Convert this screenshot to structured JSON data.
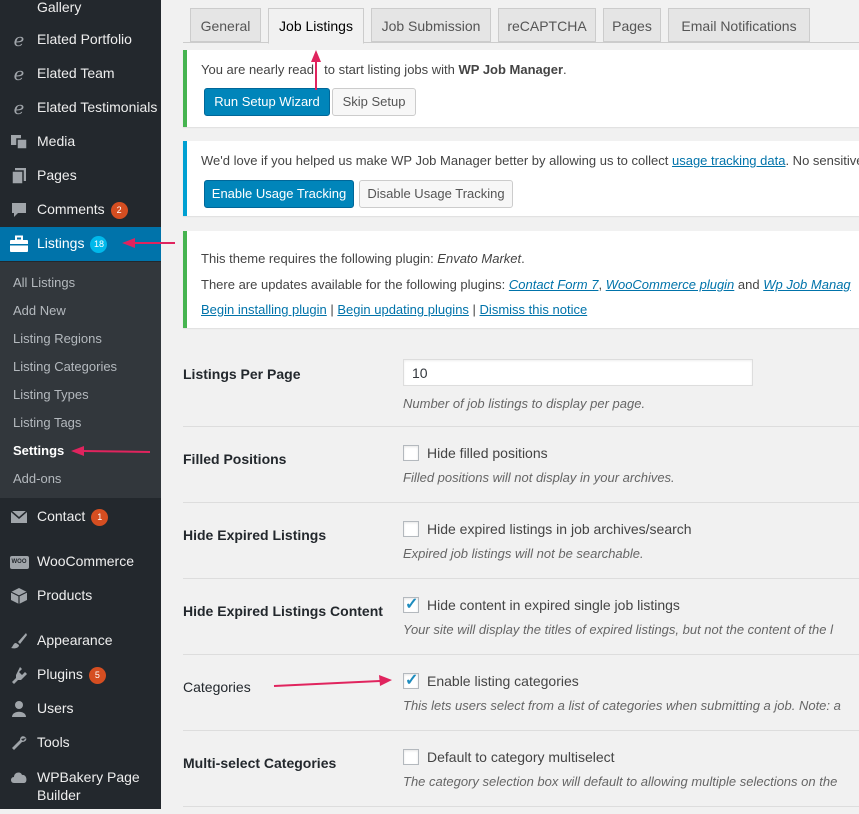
{
  "sidebar": {
    "items": [
      {
        "label": "Gallery",
        "icon": "elated-e-icon"
      },
      {
        "label": "Elated Portfolio",
        "icon": "elated-e-icon"
      },
      {
        "label": "Elated Team",
        "icon": "elated-e-icon"
      },
      {
        "label": "Elated Testimonials",
        "icon": "elated-e-icon"
      },
      {
        "label": "Media",
        "icon": "media-icon"
      },
      {
        "label": "Pages",
        "icon": "pages-icon"
      },
      {
        "label": "Comments",
        "icon": "comment-icon",
        "badge": "2"
      },
      {
        "label": "Listings",
        "icon": "briefcase-icon",
        "badge": "18",
        "active": true
      },
      {
        "label": "Contact",
        "icon": "mail-icon",
        "badge": "1"
      },
      {
        "label": "WooCommerce",
        "icon": "woo-icon"
      },
      {
        "label": "Products",
        "icon": "box-icon"
      },
      {
        "label": "Appearance",
        "icon": "brush-icon"
      },
      {
        "label": "Plugins",
        "icon": "plugin-icon",
        "badge": "5"
      },
      {
        "label": "Users",
        "icon": "user-icon"
      },
      {
        "label": "Tools",
        "icon": "wrench-icon"
      },
      {
        "label": "WPBakery Page",
        "label2": "Builder",
        "icon": "cloud-icon"
      }
    ],
    "woo_icon_text": "WOO",
    "submenu": [
      "All Listings",
      "Add New",
      "Listing Regions",
      "Listing Categories",
      "Listing Types",
      "Listing Tags",
      "Settings",
      "Add-ons"
    ],
    "submenu_current": "Settings"
  },
  "tabs": [
    "General",
    "Job Listings",
    "Job Submission",
    "reCAPTCHA",
    "Pages",
    "Email Notifications"
  ],
  "active_tab": "Job Listings",
  "notices": {
    "setup": {
      "text_prefix": "You are nearly read",
      "text_gap": "y",
      "text_mid": " to start listing jobs with ",
      "text_bold": "WP Job Manager",
      "text_suffix": ".",
      "primary_button": "Run Setup Wizard",
      "secondary_button": "Skip Setup"
    },
    "tracking": {
      "text": "We'd love if you helped us make WP Job Manager better by allowing us to collect ",
      "link": "usage tracking data",
      "text_after": ". No sensitive",
      "primary_button": "Enable Usage Tracking",
      "secondary_button": "Disable Usage Tracking"
    },
    "plugins": {
      "line1_prefix": "This theme requires the following plugin: ",
      "line1_plugin": "Envato Market",
      "line1_suffix": ".",
      "line2_prefix": "There are updates available for the following plugins: ",
      "line2_plugin1": "Contact Form 7",
      "line2_sep1": ", ",
      "line2_plugin2": "WooCommerce plugin",
      "line2_and": " and ",
      "line2_plugin3": "Wp Job Manag",
      "action_install": "Begin installing plugin",
      "action_update": "Begin updating plugins",
      "action_dismiss": "Dismiss this notice",
      "action_sep": " | "
    }
  },
  "settings": {
    "per_page": {
      "label": "Listings Per Page",
      "value": "10",
      "desc": "Number of job listings to display per page."
    },
    "filled": {
      "label": "Filled Positions",
      "checkbox": "Hide filled positions",
      "checked": false,
      "desc": "Filled positions will not display in your archives."
    },
    "hide_expired": {
      "label": "Hide Expired Listings",
      "checkbox": "Hide expired listings in job archives/search",
      "checked": false,
      "desc": "Expired job listings will not be searchable."
    },
    "hide_expired_content": {
      "label": "Hide Expired Listings Content",
      "checkbox": "Hide content in expired single job listings",
      "checked": true,
      "desc": "Your site will display the titles of expired listings, but not the content of the l"
    },
    "categories": {
      "label": "Categories",
      "checkbox": "Enable listing categories",
      "checked": true,
      "desc": "This lets users select from a list of categories when submitting a job. Note: a"
    },
    "multiselect": {
      "label": "Multi-select Categories",
      "checkbox": "Default to category multiselect",
      "checked": false,
      "desc": "The category selection box will default to allowing multiple selections on the"
    }
  },
  "colors": {
    "sidebar_bg": "#23282d",
    "active_menu": "#0073aa",
    "annotation_arrow": "#e0245e",
    "primary_button": "#0085ba",
    "notice_green": "#46b450",
    "notice_blue": "#00a0d2"
  }
}
